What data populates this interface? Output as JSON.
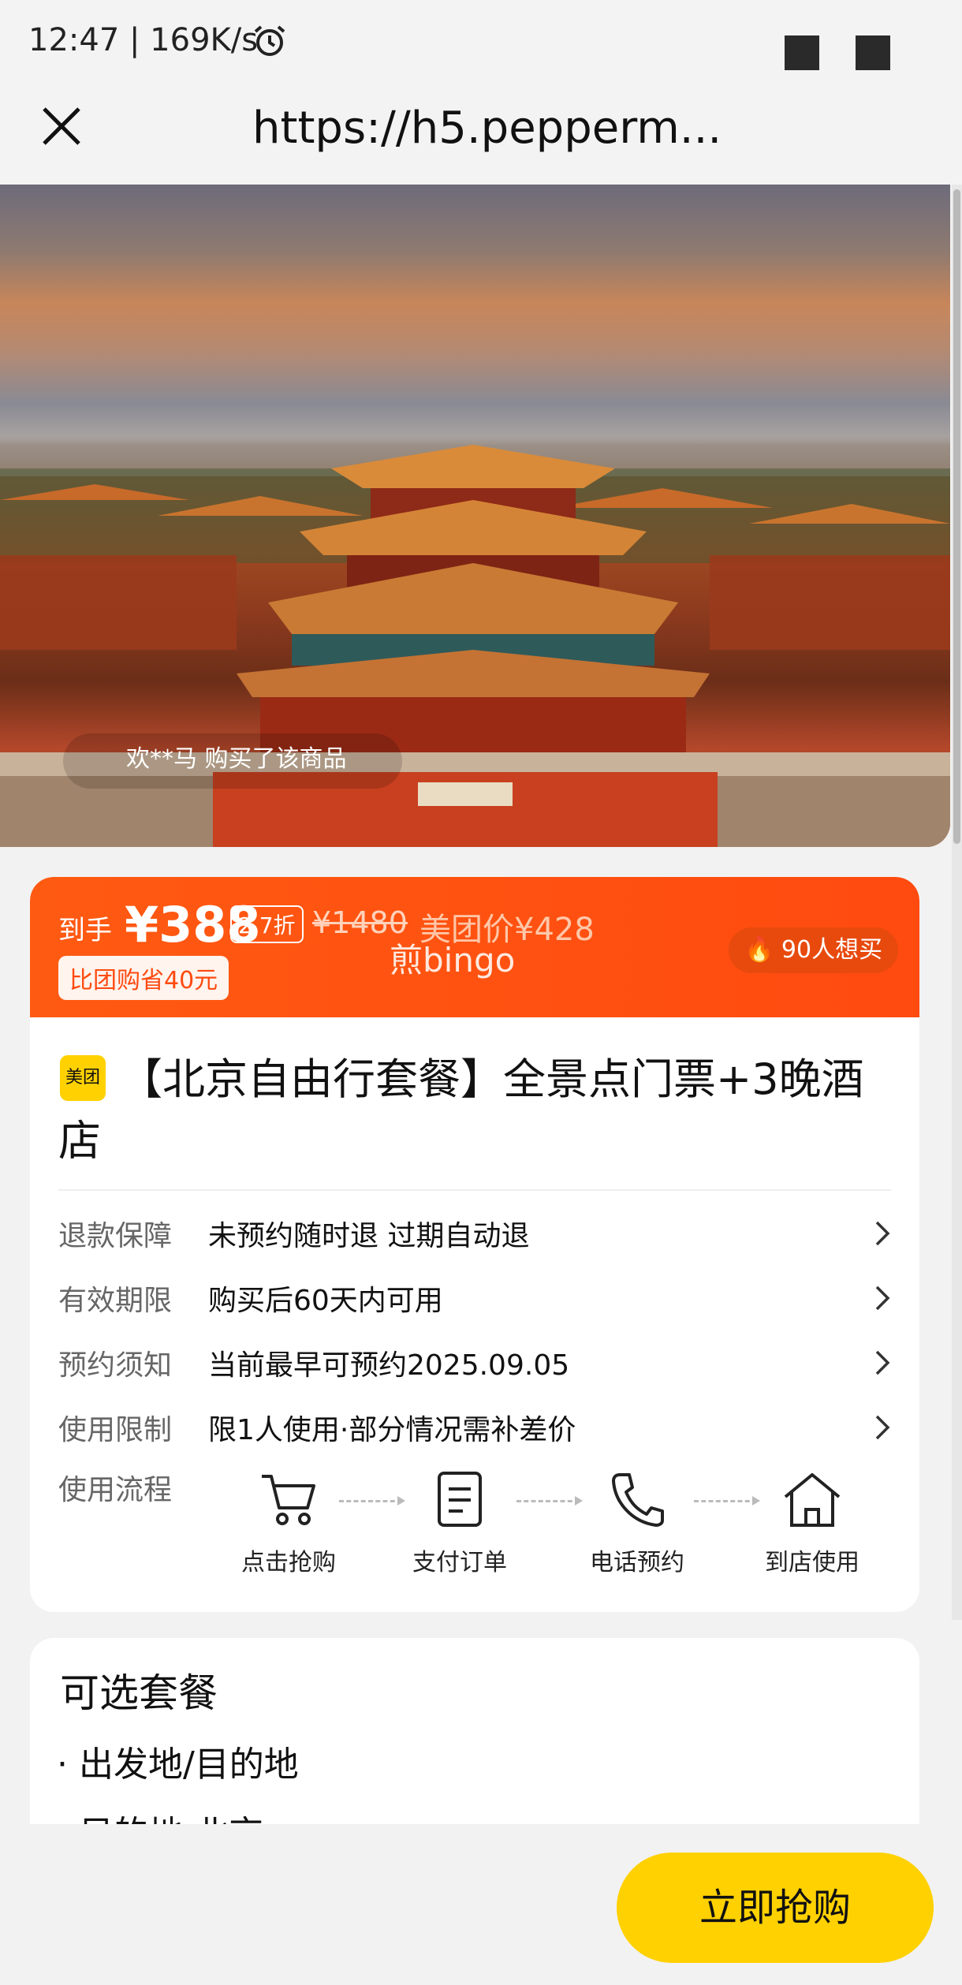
{
  "status_bar": {
    "text": "12:47 | 169K/s",
    "alarm_icon": "alarm-clock-icon"
  },
  "browser": {
    "url": "https://h5.pepperm..."
  },
  "hero": {
    "buyer_notice": "欢**马 购买了该商品"
  },
  "price": {
    "prefix": "到手",
    "current": "¥388",
    "discount": "2.7折",
    "original": "¥1480",
    "meituan_price": "美团价¥428",
    "watermark": "煎bingo",
    "save_badge": "比团购省40元",
    "want_count": "90人想买",
    "colors": {
      "accent": "#ff4a10",
      "button": "#ffd100"
    }
  },
  "product": {
    "logo_text": "美团",
    "title": "【北京自由行套餐】全景点门票+3晚酒店"
  },
  "info_rows": [
    {
      "label": "退款保障",
      "value": "未预约随时退 过期自动退"
    },
    {
      "label": "有效期限",
      "value": "购买后60天内可用"
    },
    {
      "label": "预约须知",
      "value": "当前最早可预约2025.09.05"
    },
    {
      "label": "使用限制",
      "value": "限1人使用·部分情况需补差价"
    }
  ],
  "flow": {
    "label": "使用流程",
    "steps": [
      {
        "label": "点击抢购",
        "icon": "cart-icon"
      },
      {
        "label": "支付订单",
        "icon": "document-icon"
      },
      {
        "label": "电话预约",
        "icon": "phone-icon"
      },
      {
        "label": "到店使用",
        "icon": "store-icon"
      }
    ]
  },
  "package": {
    "title": "可选套餐",
    "item1": "· 出发地/目的地",
    "item2": "· 目的地 北京"
  },
  "bottom": {
    "buy_button": "立即抢购"
  }
}
